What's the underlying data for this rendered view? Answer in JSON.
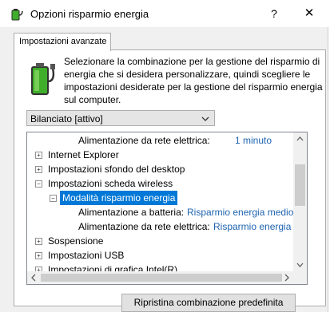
{
  "window": {
    "title": "Opzioni risparmio energia",
    "help_label": "?",
    "close_label": "✕"
  },
  "tab": {
    "label": "Impostazioni avanzate"
  },
  "description": "Selezionare la combinazione per la gestione del risparmio di energia che si desidera personalizzare, quindi scegliere le impostazioni desiderate per la gestione del risparmio energia sul computer.",
  "plan_select": {
    "value": "Bilanciato [attivo]"
  },
  "tree": {
    "rows": [
      {
        "label": "Alimentazione da rete elettrica:",
        "value": "1 minuto"
      },
      {
        "label": "Internet Explorer",
        "expander": "+"
      },
      {
        "label": "Impostazioni sfondo del desktop",
        "expander": "+"
      },
      {
        "label": "Impostazioni scheda wireless",
        "expander": "−"
      },
      {
        "label": "Modalità risparmio energia",
        "expander": "−"
      },
      {
        "label": "Alimentazione a batteria:",
        "value": "Risparmio energia medio"
      },
      {
        "label": "Alimentazione da rete elettrica:",
        "value": "Risparmio energia m"
      },
      {
        "label": "Sospensione",
        "expander": "+"
      },
      {
        "label": "Impostazioni USB",
        "expander": "+"
      },
      {
        "label": "Impostazioni di grafica Intel(R)",
        "expander": "+"
      }
    ]
  },
  "restore_button": {
    "label": "Ripristina combinazione predefinita"
  },
  "icons": {
    "app": "power-options-icon",
    "battery": "battery-icon",
    "colors": {
      "selection": "#0078d7",
      "link": "#1e63b0",
      "battery_green": "#3fae2a"
    }
  }
}
